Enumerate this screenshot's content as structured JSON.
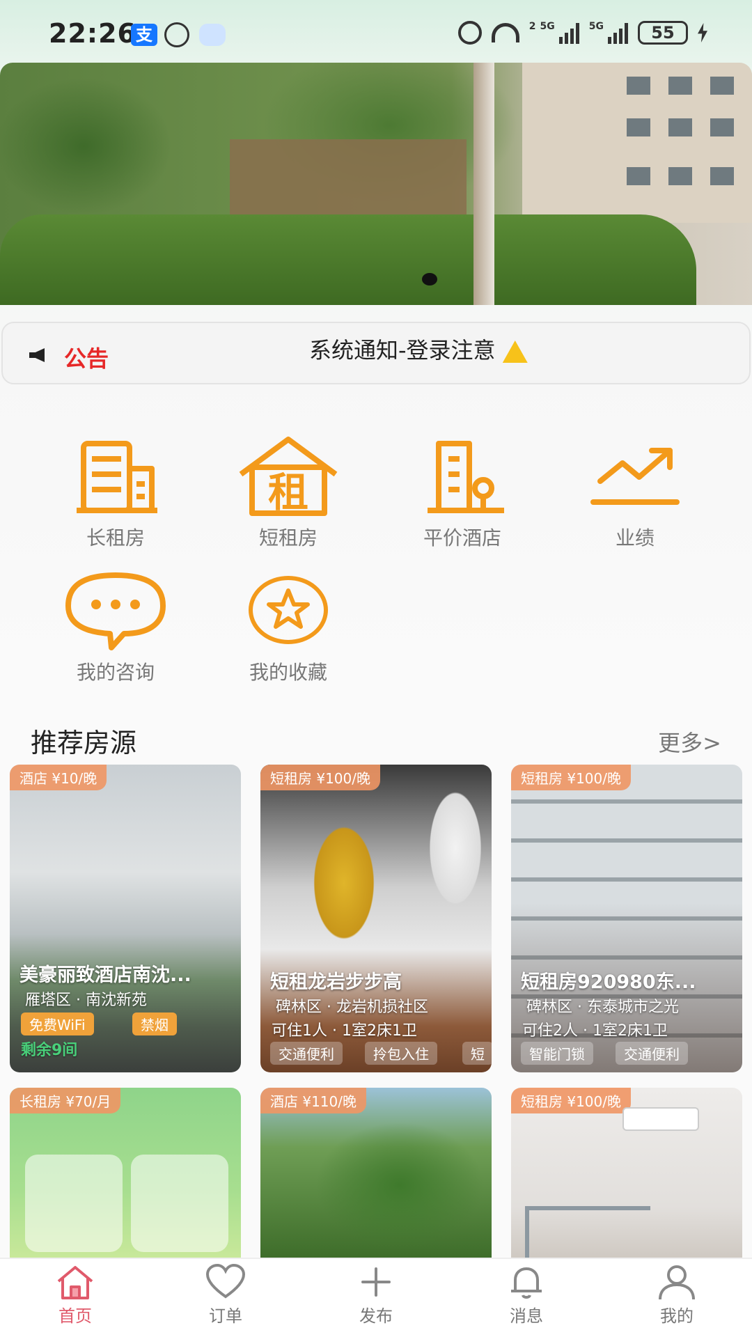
{
  "status_bar": {
    "time": "22:26",
    "battery": "55",
    "net_1": "2",
    "net_2": "5G",
    "net_3": "5G",
    "alipay_glyph": "支"
  },
  "banner": {
    "image": "trees-and-building-photo"
  },
  "notice": {
    "label": "公告",
    "text": "系统通知-登录注意",
    "icon_left": "speaker-icon",
    "icon_right": "warning-icon"
  },
  "quick_menu": [
    {
      "label": "长租房",
      "icon": "building-icon"
    },
    {
      "label": "短租房",
      "icon": "rent-house-icon",
      "glyph": "租"
    },
    {
      "label": "平价酒店",
      "icon": "hotel-icon"
    },
    {
      "label": "业绩",
      "icon": "trend-icon"
    },
    {
      "label": "我的咨询",
      "icon": "chat-bubble-icon"
    },
    {
      "label": "我的收藏",
      "icon": "star-icon"
    }
  ],
  "colors": {
    "accent": "#F39A1B",
    "notice_red": "#E62828",
    "nav_active": "#E05A6B",
    "remain_green": "#49D07A"
  },
  "recommend": {
    "title": "推荐房源",
    "more": "更多>",
    "cards": [
      {
        "tag": "酒店 ¥10/晚",
        "title": "美豪丽致酒店南沈...",
        "district": "雁塔区 · 南沈新苑",
        "pills": [
          "免费WiFi",
          "禁烟"
        ],
        "remain": "剩余9间"
      },
      {
        "tag": "短租房 ¥100/晚",
        "title": "短租龙岩步步高",
        "district": "碑林区 · 龙岩机损社区",
        "capacity": "可住1人 · 1室2床1卫",
        "pills": [
          "交通便利",
          "拎包入住",
          "短"
        ]
      },
      {
        "tag": "短租房 ¥100/晚",
        "title": "短租房920980东...",
        "district": "碑林区 · 东泰城市之光",
        "capacity": "可住2人 · 1室2床1卫",
        "pills": [
          "智能门锁",
          "交通便利"
        ]
      },
      {
        "tag": "长租房 ¥70/月"
      },
      {
        "tag": "酒店 ¥110/晚"
      },
      {
        "tag": "短租房 ¥100/晚"
      }
    ]
  },
  "bottom_nav": [
    {
      "label": "首页",
      "icon": "home-icon",
      "active": true
    },
    {
      "label": "订单",
      "icon": "heart-icon",
      "active": false
    },
    {
      "label": "发布",
      "icon": "plus-icon",
      "active": false
    },
    {
      "label": "消息",
      "icon": "bell-icon",
      "active": false
    },
    {
      "label": "我的",
      "icon": "person-icon",
      "active": false
    }
  ]
}
